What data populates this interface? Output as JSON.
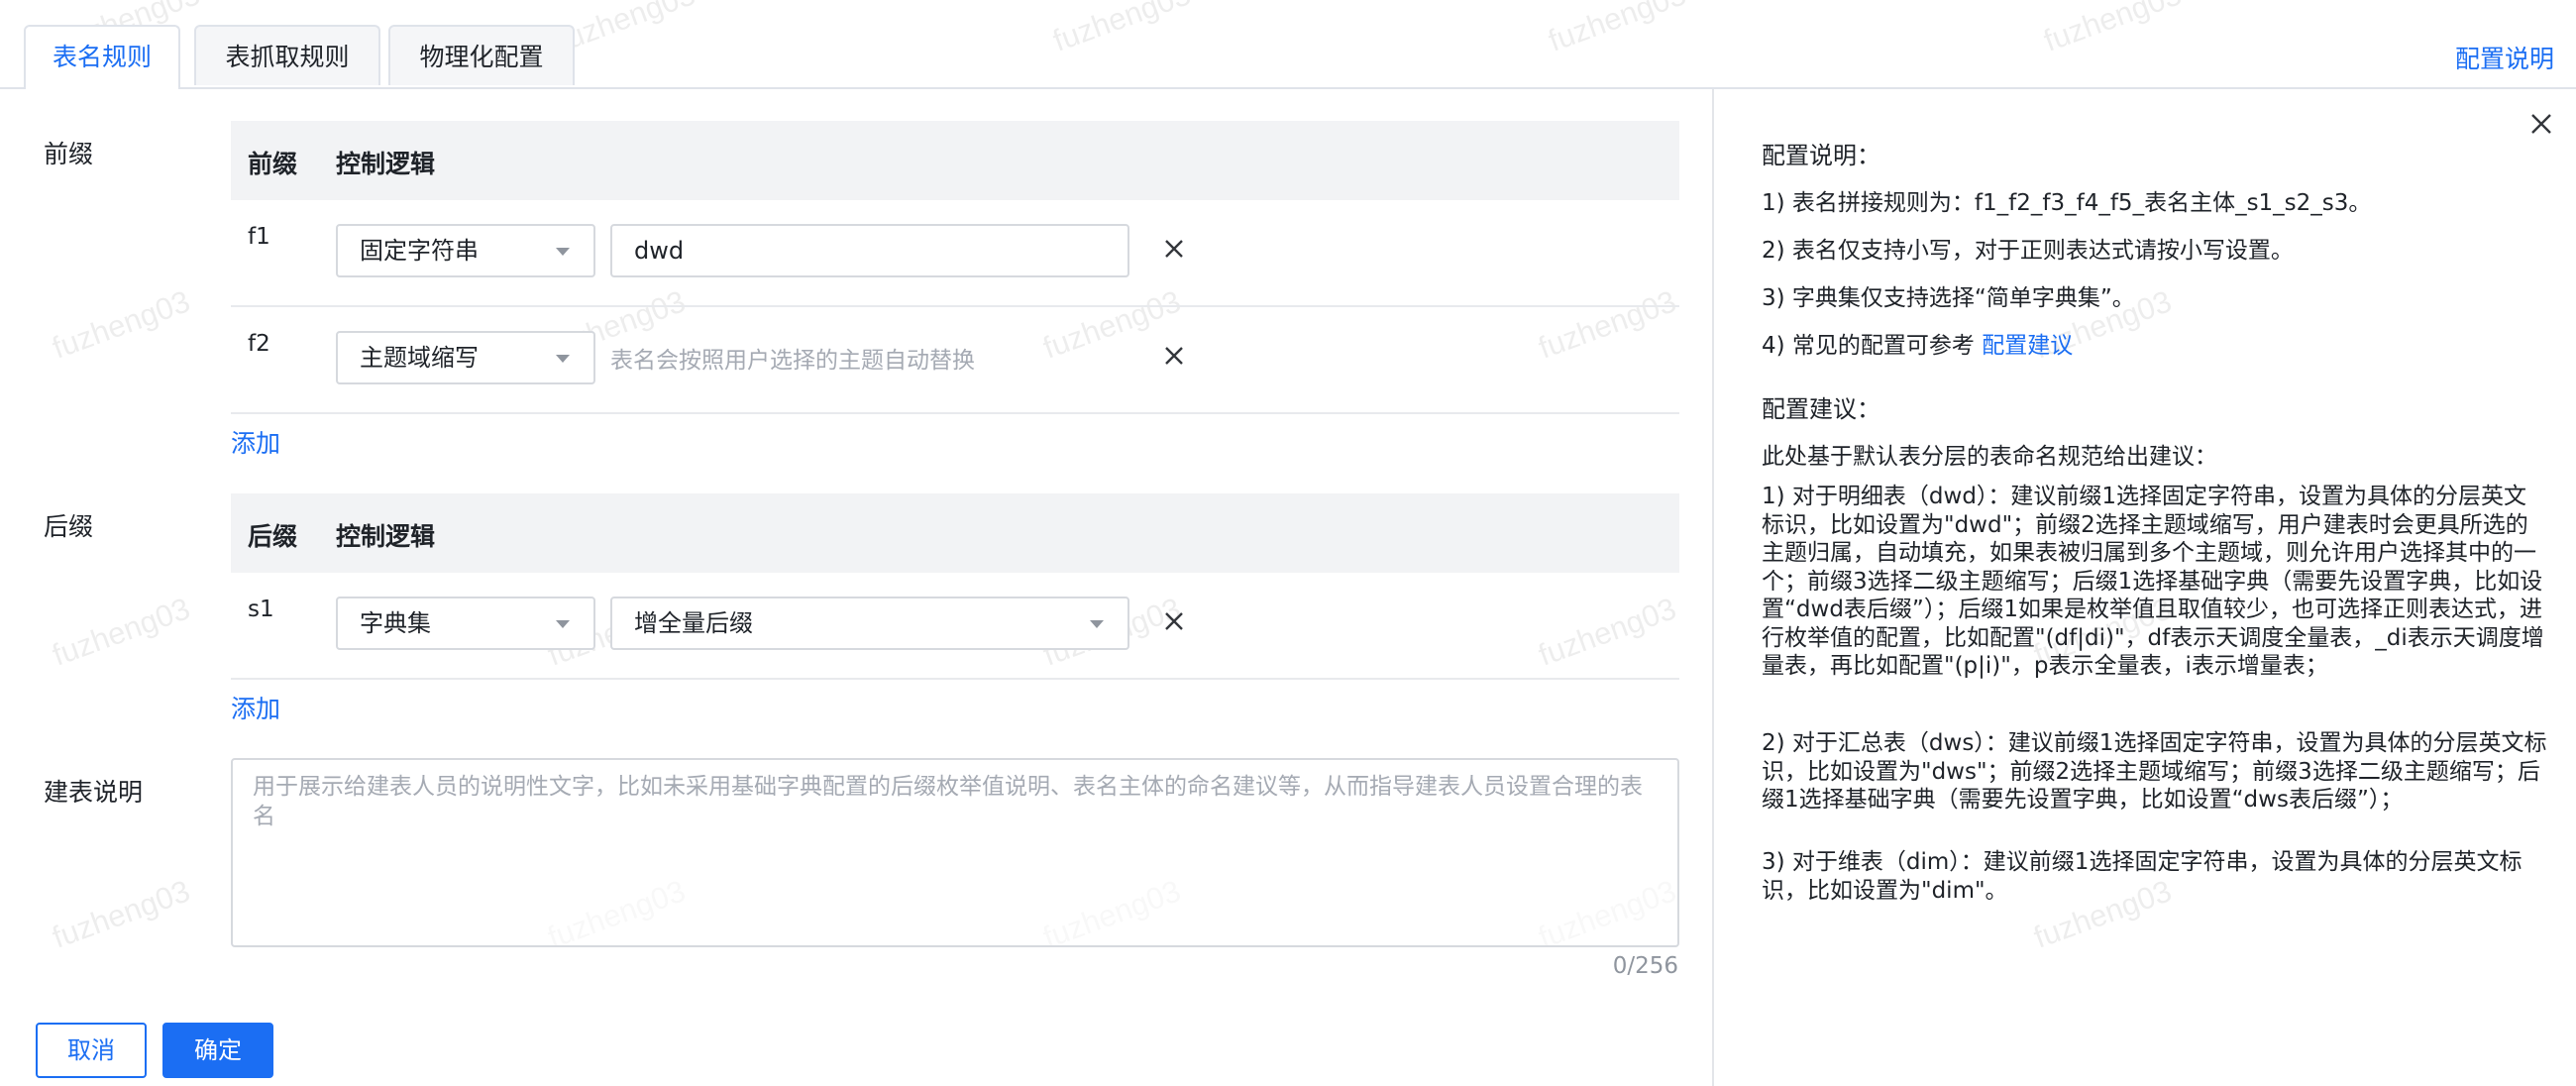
{
  "watermark": "fuzheng03",
  "tabs": [
    {
      "label": "表名规则",
      "active": true
    },
    {
      "label": "表抓取规则",
      "active": false
    },
    {
      "label": "物理化配置",
      "active": false
    }
  ],
  "config_link": "配置说明",
  "prefix": {
    "label": "前缀",
    "header": {
      "col1": "前缀",
      "col2": "控制逻辑"
    },
    "rows": [
      {
        "key": "f1",
        "select": "固定字符串",
        "input_value": "dwd"
      },
      {
        "key": "f2",
        "select": "主题域缩写",
        "hint": "表名会按照用户选择的主题自动替换"
      }
    ],
    "add_label": "添加"
  },
  "suffix": {
    "label": "后缀",
    "header": {
      "col1": "后缀",
      "col2": "控制逻辑"
    },
    "rows": [
      {
        "key": "s1",
        "select": "字典集",
        "select2": "增全量后缀"
      }
    ],
    "add_label": "添加"
  },
  "description": {
    "label": "建表说明",
    "placeholder": "用于展示给建表人员的说明性文字，比如未采用基础字典配置的后缀枚举值说明、表名主体的命名建议等，从而指导建表人员设置合理的表名",
    "counter": "0/256"
  },
  "buttons": {
    "cancel": "取消",
    "ok": "确定"
  },
  "panel": {
    "title": "配置说明：",
    "items": [
      "1) 表名拼接规则为：f1_f2_f3_f4_f5_表名主体_s1_s2_s3。",
      "2) 表名仅支持小写，对于正则表达式请按小写设置。",
      "3) 字典集仅支持选择“简单字典集”。",
      "4) 常见的配置可参考"
    ],
    "item4_link": "配置建议",
    "suggest_title": "配置建议：",
    "suggest_intro": "此处基于默认表分层的表命名规范给出建议：",
    "suggest_1": "1) 对于明细表（dwd）：建议前缀1选择固定字符串，设置为具体的分层英文标识，比如设置为\"dwd\"；前缀2选择主题域缩写，用户建表时会更具所选的主题归属，自动填充，如果表被归属到多个主题域，则允许用户选择其中的一个；前缀3选择二级主题缩写；后缀1选择基础字典（需要先设置字典，比如设置“dwd表后缀”）；后缀1如果是枚举值且取值较少，也可选择正则表达式，进行枚举值的配置，比如配置\"(df|di)\"，df表示天调度全量表，_di表示天调度增量表，再比如配置\"(p|i)\"，p表示全量表，i表示增量表；",
    "suggest_2": "2) 对于汇总表（dws）：建议前缀1选择固定字符串，设置为具体的分层英文标识，比如设置为\"dws\"；前缀2选择主题域缩写；前缀3选择二级主题缩写；后缀1选择基础字典（需要先设置字典，比如设置“dws表后缀”）；",
    "suggest_3": "3) 对于维表（dim）：建议前缀1选择固定字符串，设置为具体的分层英文标识，比如设置为\"dim\"。"
  }
}
